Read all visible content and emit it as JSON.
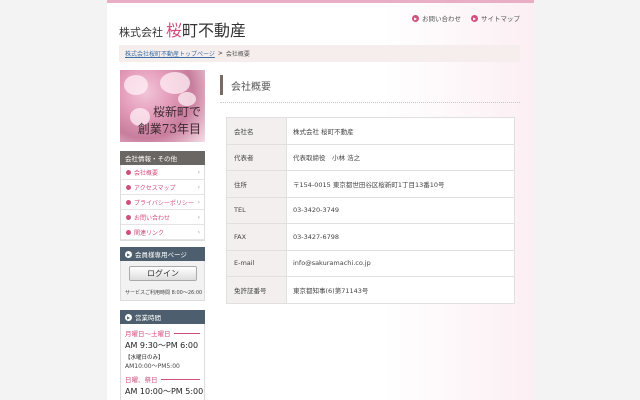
{
  "header": {
    "logo_prefix": "株式会社",
    "logo_accent": "桜",
    "logo_rest": "町不動産",
    "links": [
      {
        "label": "お問い合わせ",
        "icon": "arrow-circle-icon"
      },
      {
        "label": "サイトマップ",
        "icon": "arrow-circle-icon"
      }
    ]
  },
  "breadcrumb": {
    "home": "株式会社桜町不動産トップページ",
    "separator": ">",
    "current": "会社概要"
  },
  "banner": {
    "line1": "桜新町で",
    "line2": "創業73年目"
  },
  "sidebar": {
    "info_heading": "会社情報・その他",
    "items": [
      {
        "label": "会社概要"
      },
      {
        "label": "アクセスマップ"
      },
      {
        "label": "プライバシーポリシー"
      },
      {
        "label": "お問い合わせ"
      },
      {
        "label": "関連リンク"
      }
    ],
    "member_heading": "会員様専用ページ",
    "login_label": "ログイン",
    "member_hours": "サービスご利用時間 8:00～26:00",
    "hours_heading": "営業時間",
    "hours": {
      "weekday_label": "月曜日～土曜日",
      "weekday_time": "AM 9:30～PM 6:00",
      "wed_note": "【水曜日のみ】",
      "wed_time": "AM10:00～PM5:00",
      "holiday_label": "日曜、祭日",
      "holiday_time": "AM 10:00～PM 5:00"
    }
  },
  "main": {
    "title": "会社概要",
    "rows": [
      {
        "label": "会社名",
        "value": "株式会社 桜町不動産"
      },
      {
        "label": "代表者",
        "value": "代表取締役　小林 浩之"
      },
      {
        "label": "住所",
        "value": "〒154-0015 東京都世田谷区桜新町1丁目13番10号"
      },
      {
        "label": "TEL",
        "value": "03-3420-3749"
      },
      {
        "label": "FAX",
        "value": "03-3427-6798"
      },
      {
        "label": "E-mail",
        "value": "info@sakuramachi.co.jp"
      },
      {
        "label": "免許証番号",
        "value": "東京都知事(6)第71143号"
      }
    ]
  },
  "colors": {
    "accent": "#d24e7d",
    "sidebar_head": "#6a6663",
    "sidebar_head_blue": "#4d5f6e",
    "breadcrumb_bg": "#f6eeec"
  }
}
